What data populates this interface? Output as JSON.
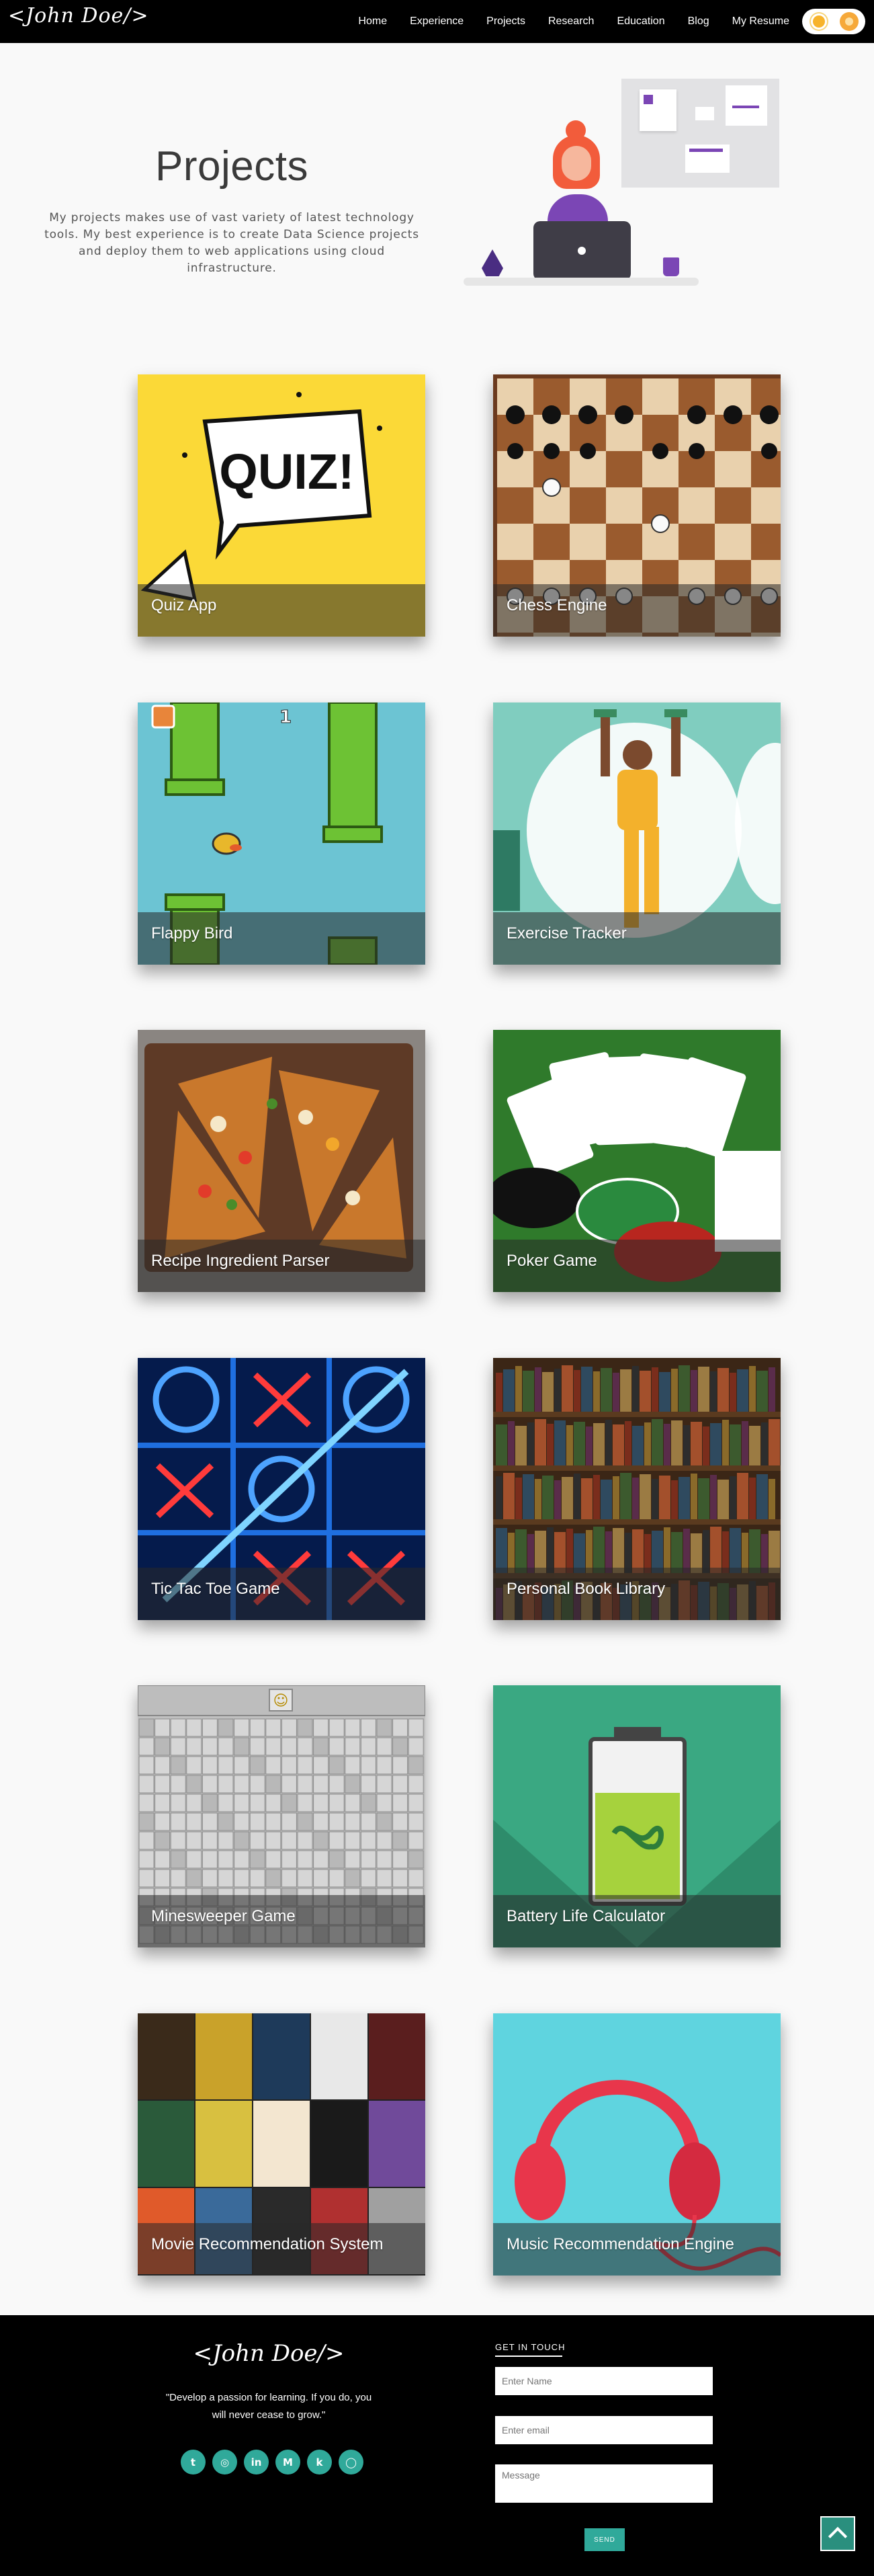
{
  "navbar": {
    "logo": "<John Doe/>",
    "links": [
      "Home",
      "Experience",
      "Projects",
      "Research",
      "Education",
      "Blog",
      "My Resume"
    ]
  },
  "hero": {
    "title": "Projects",
    "description": "My projects makes use of vast variety of latest technology tools. My best experience is to create Data Science projects and deploy them to web applications using cloud infrastructure."
  },
  "projects": [
    {
      "title": "Quiz App",
      "icon": "quiz-icon"
    },
    {
      "title": "Chess Engine",
      "icon": "chess-icon"
    },
    {
      "title": "Flappy Bird",
      "icon": "flappy-bird-icon"
    },
    {
      "title": "Exercise Tracker",
      "icon": "dumbbell-icon"
    },
    {
      "title": "Recipe Ingredient Parser",
      "icon": "pizza-icon"
    },
    {
      "title": "Poker Game",
      "icon": "cards-icon"
    },
    {
      "title": "Tic Tac Toe Game",
      "icon": "tic-tac-toe-icon"
    },
    {
      "title": "Personal Book Library",
      "icon": "bookshelf-icon"
    },
    {
      "title": "Minesweeper Game",
      "icon": "minesweeper-icon"
    },
    {
      "title": "Battery Life Calculator",
      "icon": "battery-icon"
    },
    {
      "title": "Movie Recommendation System",
      "icon": "movie-posters-icon"
    },
    {
      "title": "Music Recommendation Engine",
      "icon": "headphones-icon"
    }
  ],
  "art": {
    "quiz": "QUIZ!",
    "flappy_score": "1",
    "minesweeper_face": "☺"
  },
  "footer": {
    "logo": "<John Doe/>",
    "quote": "\"Develop a passion for learning. If you do, you will never cease to grow.\"",
    "social": [
      "twitter-icon",
      "instagram-icon",
      "linkedin-icon",
      "medium-icon",
      "kaggle-icon",
      "github-icon"
    ],
    "social_glyphs": [
      "t",
      "◎",
      "in",
      "M",
      "k",
      "◯"
    ],
    "contact": {
      "title": "GET IN TOUCH",
      "name_placeholder": "Enter Name",
      "email_placeholder": "Enter email",
      "message_placeholder": "Message",
      "send_label": "SEND"
    }
  },
  "colors": {
    "accent": "#30a99a",
    "navbar": "#000000",
    "illustration_purple": "#7b46b5"
  }
}
